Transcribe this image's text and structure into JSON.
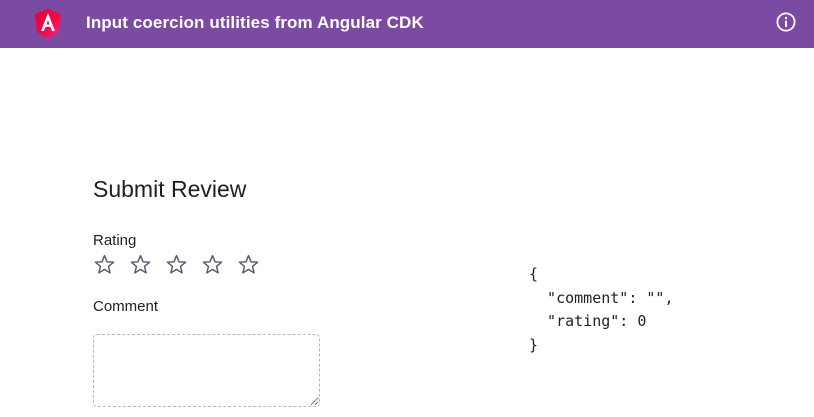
{
  "header": {
    "title": "Input coercion utilities from Angular CDK",
    "logo_icon": "angular-logo-icon",
    "info_icon": "info-icon",
    "background_color": "#7b4aa3"
  },
  "form": {
    "heading": "Submit Review",
    "rating_label": "Rating",
    "rating": {
      "value": 0,
      "max": 5,
      "star_icon": "star-outline-icon"
    },
    "comment_label": "Comment",
    "comment_value": ""
  },
  "output": {
    "open_brace": "{",
    "comment_line": "  \"comment\": \"\",",
    "rating_line": "  \"rating\": 0",
    "close_brace": "}"
  }
}
